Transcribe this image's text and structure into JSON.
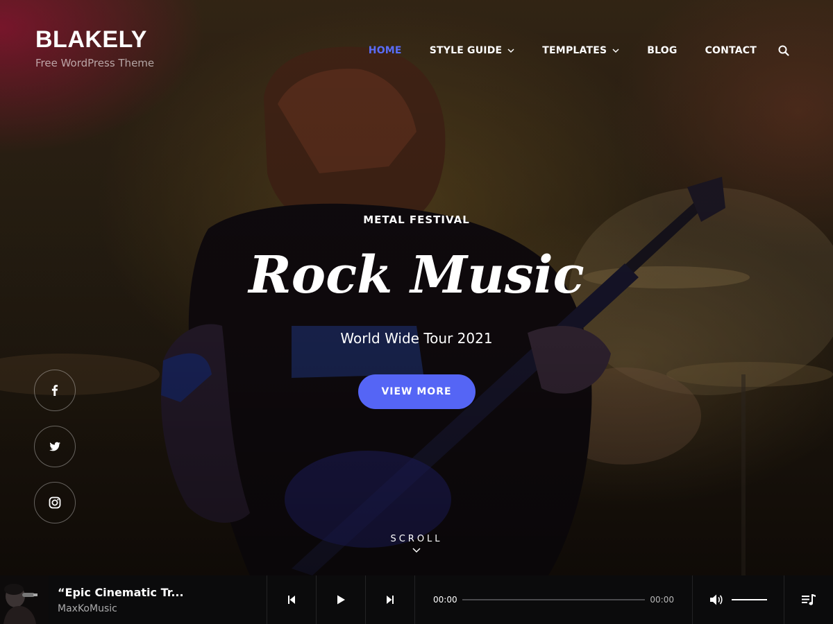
{
  "site": {
    "title": "BLAKELY",
    "tagline": "Free WordPress Theme"
  },
  "nav": {
    "items": [
      {
        "label": "HOME",
        "active": true,
        "has_dropdown": false
      },
      {
        "label": "STYLE GUIDE",
        "active": false,
        "has_dropdown": true
      },
      {
        "label": "TEMPLATES",
        "active": false,
        "has_dropdown": true
      },
      {
        "label": "BLOG",
        "active": false,
        "has_dropdown": false
      },
      {
        "label": "CONTACT",
        "active": false,
        "has_dropdown": false
      }
    ],
    "search_icon": "search-icon"
  },
  "hero": {
    "eyebrow": "METAL FESTIVAL",
    "headline": "Rock Music",
    "subline": "World Wide Tour 2021",
    "cta_label": "VIEW MORE",
    "scroll_label": "SCROLL"
  },
  "social": [
    {
      "network": "facebook",
      "icon": "facebook-icon"
    },
    {
      "network": "twitter",
      "icon": "twitter-icon"
    },
    {
      "network": "instagram",
      "icon": "instagram-icon"
    }
  ],
  "player": {
    "track_title": "“Epic Cinematic Tr...",
    "artist": "MaxKoMusic",
    "current_time": "00:00",
    "duration": "00:00",
    "progress": 0,
    "volume": 1.0
  },
  "colors": {
    "accent": "#5565f5",
    "nav_active": "#5a6cf8",
    "player_bg": "#0b0b0c"
  }
}
